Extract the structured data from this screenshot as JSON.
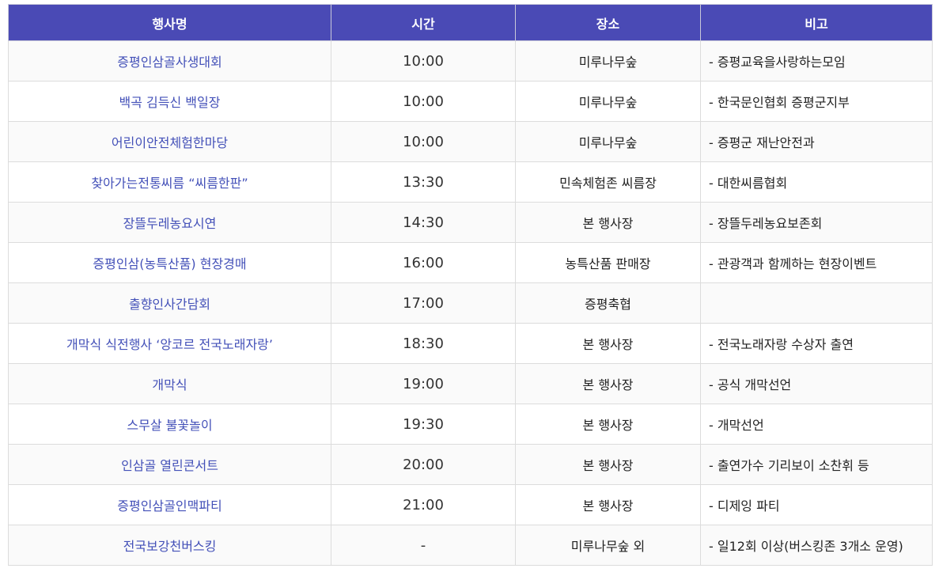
{
  "table": {
    "headers": [
      "행사명",
      "시간",
      "장소",
      "비고"
    ],
    "rows": [
      {
        "name": "증평인삼골사생대회",
        "time": "10:00",
        "place": "미루나무숲",
        "note": "- 증평교육을사랑하는모임"
      },
      {
        "name": "백곡 김득신 백일장",
        "time": "10:00",
        "place": "미루나무숲",
        "note": "- 한국문인협회 증평군지부"
      },
      {
        "name": "어린이안전체험한마당",
        "time": "10:00",
        "place": "미루나무숲",
        "note": "- 증평군 재난안전과"
      },
      {
        "name": "찾아가는전통씨름 “씨름한판”",
        "time": "13:30",
        "place": "민속체험존 씨름장",
        "note": "- 대한씨름협회"
      },
      {
        "name": "장뜰두레농요시연",
        "time": "14:30",
        "place": "본 행사장",
        "note": "- 장뜰두레농요보존회"
      },
      {
        "name": "증평인삼(농특산품) 현장경매",
        "time": "16:00",
        "place": "농특산품 판매장",
        "note": "- 관광객과 함께하는 현장이벤트"
      },
      {
        "name": "출향인사간담회",
        "time": "17:00",
        "place": "증평축협",
        "note": ""
      },
      {
        "name": "개막식 식전행사 ‘앙코르 전국노래자랑’",
        "time": "18:30",
        "place": "본 행사장",
        "note": "- 전국노래자랑 수상자 출연"
      },
      {
        "name": "개막식",
        "time": "19:00",
        "place": "본 행사장",
        "note": "- 공식 개막선언"
      },
      {
        "name": "스무살 불꽃놀이",
        "time": "19:30",
        "place": "본 행사장",
        "note": "- 개막선언"
      },
      {
        "name": "인삼골 열린콘서트",
        "time": "20:00",
        "place": "본 행사장",
        "note": "- 출연가수 기리보이 소찬휘 등"
      },
      {
        "name": "증평인삼골인맥파티",
        "time": "21:00",
        "place": "본 행사장",
        "note": "- 디제잉 파티"
      },
      {
        "name": "전국보강천버스킹",
        "time": "-",
        "place": "미루나무숲 외",
        "note": "- 일12회 이상(버스킹존 3개소 운영)"
      }
    ]
  },
  "colors": {
    "header_bg": "#4a4ab5",
    "header_text": "#ffffff",
    "event_name_text": "#4350b8",
    "border": "#dcdcdc"
  }
}
